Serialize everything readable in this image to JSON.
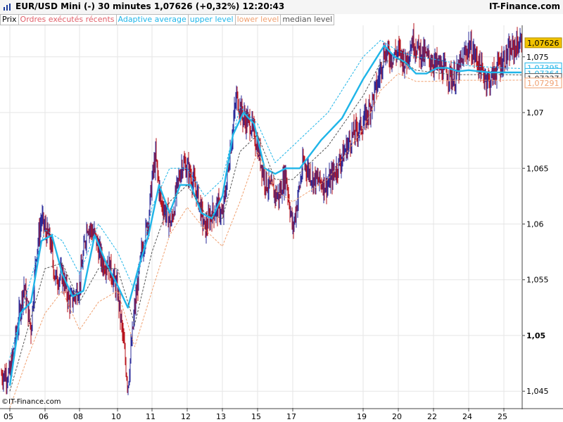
{
  "header": {
    "title": "EUR/USD Mini (-)   30 minutes   1,07626 (+0,32%)   12:20:43",
    "brand": "IT-Finance.com"
  },
  "legend": [
    {
      "label": "Prix",
      "color": "#000000"
    },
    {
      "label": "Ordres exécutés récents",
      "color": "#e0606a"
    },
    {
      "label": "Adaptive average",
      "color": "#1fb5e8"
    },
    {
      "label": "upper level",
      "color": "#1fb5e8"
    },
    {
      "label": "lower level",
      "color": "#f0a070"
    },
    {
      "label": "median level",
      "color": "#555555"
    }
  ],
  "copyright": "©IT-Finance.com",
  "colors": {
    "up": "#2b2b9a",
    "down": "#b8141e",
    "adaptive": "#1fb5e8",
    "upper": "#1fb5e8",
    "lower": "#f0a070",
    "median": "#555555",
    "grid": "#e6e6e6",
    "price_tag": "#f2c300"
  },
  "chart_data": {
    "type": "line",
    "title": "EUR/USD Mini (-) 30 minutes",
    "x_ticks": [
      "05",
      "06",
      "08",
      "10",
      "11",
      "12",
      "13",
      "15",
      "17",
      "19",
      "20",
      "22",
      "24",
      "25"
    ],
    "x_tick_index": [
      0,
      1,
      2,
      3,
      4,
      5,
      6,
      7,
      8,
      9,
      10,
      11,
      12,
      13
    ],
    "y_ticks": [
      "1,045",
      "1,05",
      "1,055",
      "1,06",
      "1,065",
      "1,07",
      "1,075"
    ],
    "y_tick_values": [
      1.045,
      1.05,
      1.055,
      1.06,
      1.065,
      1.07,
      1.075
    ],
    "y_bold_tick": "1,05",
    "ylim": [
      1.0435,
      1.0777
    ],
    "grid": true,
    "price_tags": [
      {
        "label": "1,07626",
        "value": 1.07626,
        "style": "last"
      },
      {
        "label": "1,07395",
        "value": 1.07395,
        "style": "upper"
      },
      {
        "label": "1,07364",
        "value": 1.07364,
        "style": "adaptive"
      },
      {
        "label": "1,07337",
        "value": 1.07337,
        "style": "median"
      },
      {
        "label": "1,07291",
        "value": 1.07291,
        "style": "lower"
      }
    ],
    "series": [
      {
        "name": "Prix",
        "x": [
          0,
          0.2,
          0.4,
          0.6,
          0.75,
          0.9,
          1.0,
          1.15,
          1.3,
          1.5,
          1.7,
          1.85,
          2.0,
          2.2,
          2.4,
          2.6,
          2.75,
          2.9,
          3.0,
          3.15,
          3.3,
          3.5,
          3.7,
          3.9,
          4.0,
          4.1,
          4.25,
          4.4,
          4.55,
          4.7,
          4.85,
          5.0,
          5.15,
          5.3,
          5.5,
          5.7,
          5.9,
          6.0,
          6.2,
          6.4,
          6.6,
          6.8,
          7.0,
          7.2,
          7.4,
          7.6,
          7.8,
          8.0,
          8.15,
          8.3,
          8.5,
          8.7,
          8.85,
          9.0,
          9.2,
          9.4,
          9.6,
          9.8,
          10.0,
          10.2,
          10.4,
          10.6,
          10.8,
          11.0,
          11.2,
          11.4,
          11.6,
          11.8,
          12.0,
          12.2,
          12.4,
          12.6,
          12.8,
          13.0,
          13.2,
          13.35,
          13.5
        ],
        "values": [
          1.0465,
          1.0505,
          1.0545,
          1.0505,
          1.0575,
          1.0605,
          1.0595,
          1.0585,
          1.055,
          1.0555,
          1.053,
          1.0535,
          1.0545,
          1.06,
          1.059,
          1.0565,
          1.0565,
          1.055,
          1.054,
          1.05,
          1.0455,
          1.0525,
          1.0575,
          1.0605,
          1.064,
          1.066,
          1.062,
          1.061,
          1.06,
          1.063,
          1.0655,
          1.065,
          1.064,
          1.0625,
          1.0595,
          1.061,
          1.0615,
          1.0605,
          1.066,
          1.0715,
          1.0695,
          1.069,
          1.067,
          1.064,
          1.063,
          1.0625,
          1.0645,
          1.0595,
          1.0655,
          1.064,
          1.0635,
          1.066,
          1.068,
          1.069,
          1.0705,
          1.0725,
          1.0755,
          1.075,
          1.0755,
          1.0745,
          1.0765,
          1.0755,
          1.075,
          1.0745,
          1.074,
          1.0735,
          1.073,
          1.0745,
          1.076,
          1.075,
          1.0735,
          1.0728,
          1.074,
          1.0748,
          1.0755,
          1.076,
          1.0763
        ]
      },
      {
        "name": "Adaptive average",
        "x": [
          0,
          0.3,
          0.6,
          0.9,
          1.2,
          1.5,
          1.8,
          2.1,
          2.4,
          2.7,
          3.0,
          3.3,
          3.6,
          3.9,
          4.2,
          4.5,
          4.8,
          5.1,
          5.4,
          5.7,
          6.0,
          6.3,
          6.6,
          6.9,
          7.2,
          7.5,
          7.8,
          8.1,
          8.4,
          8.7,
          9.0,
          9.3,
          9.6,
          9.9,
          10.2,
          10.5,
          10.8,
          11.1,
          11.4,
          11.7,
          12.0,
          12.3,
          12.6,
          12.9,
          13.2,
          13.5
        ],
        "values": [
          1.0455,
          1.052,
          1.053,
          1.0585,
          1.059,
          1.0555,
          1.0535,
          1.054,
          1.059,
          1.0565,
          1.0545,
          1.0525,
          1.056,
          1.059,
          1.0635,
          1.061,
          1.0635,
          1.0635,
          1.061,
          1.0605,
          1.0625,
          1.068,
          1.07,
          1.069,
          1.065,
          1.0645,
          1.065,
          1.065,
          1.0675,
          1.0695,
          1.073,
          1.0745,
          1.076,
          1.075,
          1.0745,
          1.0735,
          1.0735,
          1.074,
          1.074,
          1.0737,
          1.0738,
          1.0737,
          1.0736,
          1.0736,
          1.0736,
          1.0736
        ]
      },
      {
        "name": "upper level",
        "x": [
          0,
          0.5,
          1.0,
          1.5,
          2.0,
          2.5,
          3.0,
          3.5,
          4.0,
          4.5,
          5.0,
          5.5,
          6.0,
          6.5,
          7.0,
          7.5,
          8.0,
          8.5,
          9.0,
          9.5,
          10.0,
          10.5,
          11.0,
          11.5,
          12.0,
          12.5,
          13.0,
          13.5
        ],
        "values": [
          1.048,
          1.054,
          1.0595,
          1.0585,
          1.0555,
          1.06,
          1.0575,
          1.054,
          1.0615,
          1.065,
          1.065,
          1.0625,
          1.064,
          1.0705,
          1.069,
          1.0655,
          1.067,
          1.07,
          1.075,
          1.0765,
          1.0755,
          1.075,
          1.0748,
          1.0745,
          1.0742,
          1.0741,
          1.074,
          1.07395
        ]
      },
      {
        "name": "median level",
        "x": [
          0,
          0.5,
          1.0,
          1.5,
          2.0,
          2.5,
          3.0,
          3.5,
          4.0,
          4.5,
          5.0,
          5.5,
          6.0,
          6.5,
          7.0,
          7.5,
          8.0,
          8.5,
          9.0,
          9.5,
          10.0,
          10.5,
          11.0,
          11.5,
          12.0,
          12.5,
          13.0,
          13.5
        ],
        "values": [
          1.045,
          1.0505,
          1.056,
          1.0565,
          1.053,
          1.056,
          1.056,
          1.051,
          1.0575,
          1.062,
          1.0635,
          1.061,
          1.0605,
          1.0665,
          1.068,
          1.064,
          1.064,
          1.067,
          1.0715,
          1.0745,
          1.0748,
          1.0738,
          1.0736,
          1.0734,
          1.0734,
          1.0734,
          1.0734,
          1.07337
        ]
      },
      {
        "name": "lower level",
        "x": [
          0,
          0.5,
          1.0,
          1.5,
          2.0,
          2.5,
          3.0,
          3.5,
          4.0,
          4.5,
          5.0,
          5.5,
          6.0,
          6.5,
          7.0,
          7.5,
          8.0,
          8.5,
          9.0,
          9.5,
          10.0,
          10.5,
          11.0,
          11.5,
          12.0,
          12.5,
          13.0,
          13.5
        ],
        "values": [
          1.0435,
          1.048,
          1.052,
          1.054,
          1.0505,
          1.053,
          1.054,
          1.049,
          1.054,
          1.059,
          1.0615,
          1.0595,
          1.058,
          1.062,
          1.0665,
          1.063,
          1.062,
          1.064,
          1.0685,
          1.072,
          1.0735,
          1.0728,
          1.0728,
          1.0729,
          1.0729,
          1.0729,
          1.0729,
          1.07291
        ]
      }
    ]
  }
}
